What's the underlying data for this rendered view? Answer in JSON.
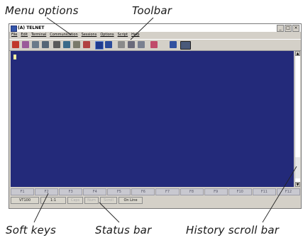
{
  "callouts": {
    "menu_options": "Menu options",
    "toolbar": "Toolbar",
    "soft_keys": "Soft keys",
    "status_bar": "Status bar",
    "history_scroll_bar": "History scroll bar"
  },
  "window": {
    "title": "(A) TELNET",
    "controls": {
      "minimize": "_",
      "maximize": "□",
      "close": "×"
    }
  },
  "menu": {
    "items": [
      "File",
      "Edit",
      "Terminal",
      "Communication",
      "Sessions",
      "Options",
      "Script",
      "Help"
    ]
  },
  "toolbar": {
    "icons": [
      "new-session-icon",
      "connect-icon",
      "copy-icon",
      "paste-icon",
      "print-icon",
      "find-icon",
      "settings-icon",
      "disconnect-icon",
      "terminal-view-icon",
      "window-view-icon",
      "cut-icon",
      "clear-icon",
      "list-icon",
      "transfer-icon",
      "screen-icon",
      "help-pointer-icon"
    ]
  },
  "softkeys": [
    "F1",
    "F2",
    "F3",
    "F4",
    "F5",
    "F6",
    "F7",
    "F8",
    "F9",
    "F10",
    "F11",
    "F12"
  ],
  "status": {
    "emulation": "VT100",
    "position": "1:1",
    "caps": "Caps",
    "num": "Num",
    "scroll": "Scroll",
    "connection": "On Line"
  },
  "colors": {
    "terminal_background": "#232a7a",
    "cursor": "#f4f0a0"
  }
}
